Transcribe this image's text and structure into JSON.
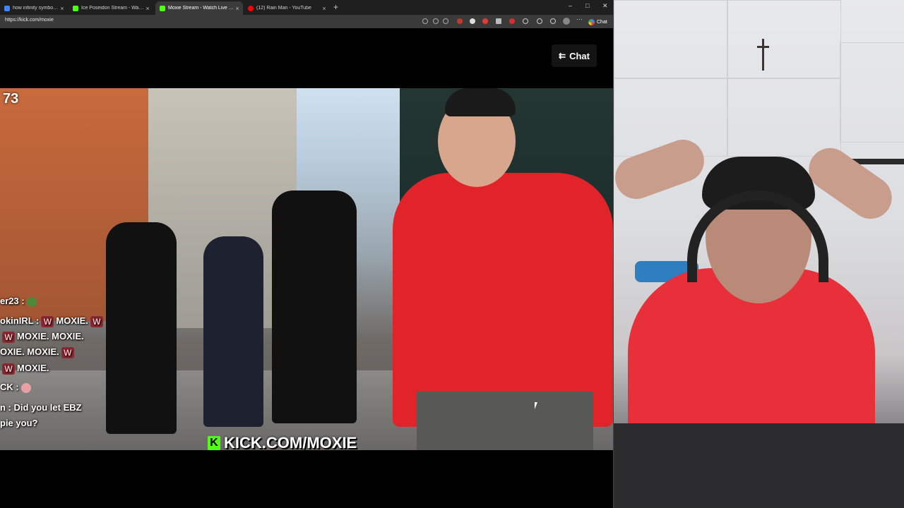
{
  "browser": {
    "tabs": [
      {
        "label": "how infinity symbol - Google",
        "favicon_color": "#4285f4",
        "active": false
      },
      {
        "label": "Ice Poseidon Stream - Watch Live",
        "favicon_color": "#53fc18",
        "active": false
      },
      {
        "label": "Moxie Stream - Watch Live on Kick",
        "favicon_color": "#53fc18",
        "active": true
      },
      {
        "label": "(12) Rain Man - YouTube",
        "favicon_color": "#ff0000",
        "active": false
      }
    ],
    "tab_close": "×",
    "new_tab": "+",
    "window_controls": {
      "minimize": "–",
      "maximize": "□",
      "close": "✕"
    },
    "url": "https://kick.com/moxie",
    "chat_label": "Chat"
  },
  "player": {
    "chat_button_label": "Chat",
    "counter": "73",
    "watermark": "KICK.COM/MOXIE",
    "kick_icon": "K",
    "chat_overlay": [
      {
        "user": "er23 :",
        "message": "",
        "emote": "frog"
      },
      {
        "user": "okinIRL :",
        "message": "MOXIE.",
        "emote": "w"
      },
      {
        "user": "",
        "message": "MOXIE.  MOXIE.",
        "emote": "w"
      },
      {
        "user": "",
        "message": "OXIE.  MOXIE.",
        "emote": "w"
      },
      {
        "user": "",
        "message": "MOXIE.",
        "emote": "w"
      },
      {
        "user": "CK :",
        "message": "",
        "emote": "heart"
      },
      {
        "user": "n :",
        "message": "Did you let EBZ",
        "emote": ""
      },
      {
        "user": "",
        "message": "pie you?",
        "emote": ""
      }
    ]
  },
  "colors": {
    "kick_green": "#53fc18",
    "shirt_red": "#e0242a"
  }
}
